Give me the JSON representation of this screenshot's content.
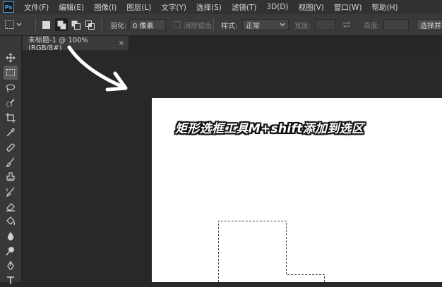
{
  "app": {
    "logo_text": "Ps"
  },
  "menu": [
    "文件(F)",
    "编辑(E)",
    "图像(I)",
    "图层(L)",
    "文字(Y)",
    "选择(S)",
    "滤镜(T)",
    "3D(D)",
    "视图(V)",
    "窗口(W)",
    "帮助(H)"
  ],
  "options": {
    "feather_label": "羽化:",
    "feather_value": "0 像素",
    "antialias_label": "消除锯齿",
    "style_label": "样式:",
    "style_value": "正常",
    "width_label": "宽度:",
    "height_label": "高度:",
    "select_mask_label": "选择并"
  },
  "document": {
    "tab_title": "未标题-1 @ 100%(RGB/8#)",
    "close_glyph": "×"
  },
  "overlay": {
    "caption": "矩形选框工具M+shift添加到选区"
  },
  "colors": {
    "accent": "#31a8ff",
    "canvas": "#ffffff",
    "workspace": "#282828"
  },
  "icons": {
    "tools": [
      "move-tool-icon",
      "rectangular-marquee-icon",
      "lasso-icon",
      "quick-selection-icon",
      "crop-icon",
      "eyedropper-icon",
      "healing-brush-icon",
      "brush-icon",
      "clone-stamp-icon",
      "history-brush-icon",
      "eraser-icon",
      "paint-bucket-icon",
      "blur-icon",
      "dodge-icon",
      "pen-icon",
      "type-icon"
    ]
  }
}
